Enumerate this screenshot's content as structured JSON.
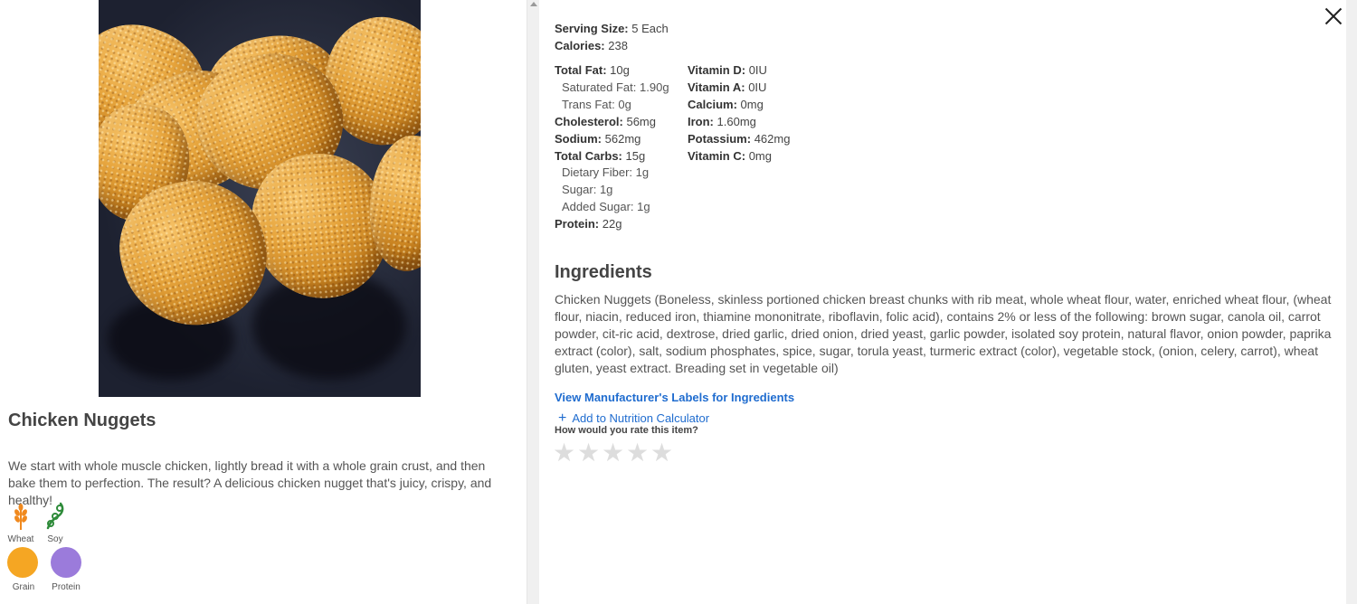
{
  "item": {
    "title": "Chicken Nuggets",
    "description": "We start with whole muscle chicken, lightly bread it with a whole grain crust, and then bake them to perfection. The result? A delicious chicken nugget that's juicy, crispy, and healthy!"
  },
  "allergens": [
    {
      "label": "Wheat",
      "icon": "wheat-icon",
      "color": "#f0891e"
    },
    {
      "label": "Soy",
      "icon": "soy-icon",
      "color": "#2e8b3a"
    }
  ],
  "food_groups": [
    {
      "label": "Grain",
      "color": "#f5a623"
    },
    {
      "label": "Protein",
      "color": "#9b7bdb"
    }
  ],
  "nutrition": {
    "serving_size": {
      "label": "Serving Size:",
      "value": "5 Each"
    },
    "calories": {
      "label": "Calories:",
      "value": "238"
    },
    "left": [
      {
        "label": "Total Fat:",
        "value": "10g",
        "sub": false
      },
      {
        "label": "Saturated Fat:",
        "value": "1.90g",
        "sub": true
      },
      {
        "label": "Trans Fat:",
        "value": "0g",
        "sub": true
      },
      {
        "label": "Cholesterol:",
        "value": "56mg",
        "sub": false
      },
      {
        "label": "Sodium:",
        "value": "562mg",
        "sub": false
      },
      {
        "label": "Total Carbs:",
        "value": "15g",
        "sub": false
      },
      {
        "label": "Dietary Fiber:",
        "value": "1g",
        "sub": true
      },
      {
        "label": "Sugar:",
        "value": "1g",
        "sub": true
      },
      {
        "label": "Added Sugar:",
        "value": "1g",
        "sub": true
      },
      {
        "label": "Protein:",
        "value": "22g",
        "sub": false
      }
    ],
    "right": [
      {
        "label": "Vitamin D:",
        "value": "0IU"
      },
      {
        "label": "Vitamin A:",
        "value": "0IU"
      },
      {
        "label": "Calcium:",
        "value": "0mg"
      },
      {
        "label": "Iron:",
        "value": "1.60mg"
      },
      {
        "label": "Potassium:",
        "value": "462mg"
      },
      {
        "label": "Vitamin C:",
        "value": "0mg"
      }
    ]
  },
  "ingredients": {
    "heading": "Ingredients",
    "text": "Chicken Nuggets (Boneless, skinless portioned chicken breast chunks with rib meat, whole wheat flour, water, enriched wheat flour, (wheat flour, niacin, reduced iron, thiamine mononitrate, riboflavin, folic acid), contains 2% or less of the following: brown sugar, canola oil, carrot powder, cit-ric acid, dextrose, dried garlic, dried onion, dried yeast, garlic powder, isolated soy protein, natural flavor, onion powder, paprika extract (color), salt, sodium phosphates, spice, sugar, torula yeast, turmeric extract (color), vegetable stock, (onion, celery, carrot), wheat gluten, yeast extract. Breading set in vegetable oil)"
  },
  "actions": {
    "manufacturer_link": "View Manufacturer's Labels for Ingredients",
    "add_plus": "+",
    "add_calculator": "Add to Nutrition Calculator",
    "rate_question": "How would you rate this item?",
    "star_glyph": "★",
    "rating": 0,
    "max_rating": 5
  },
  "colors": {
    "link": "#1f6ccf",
    "star_empty": "#dddddd"
  }
}
